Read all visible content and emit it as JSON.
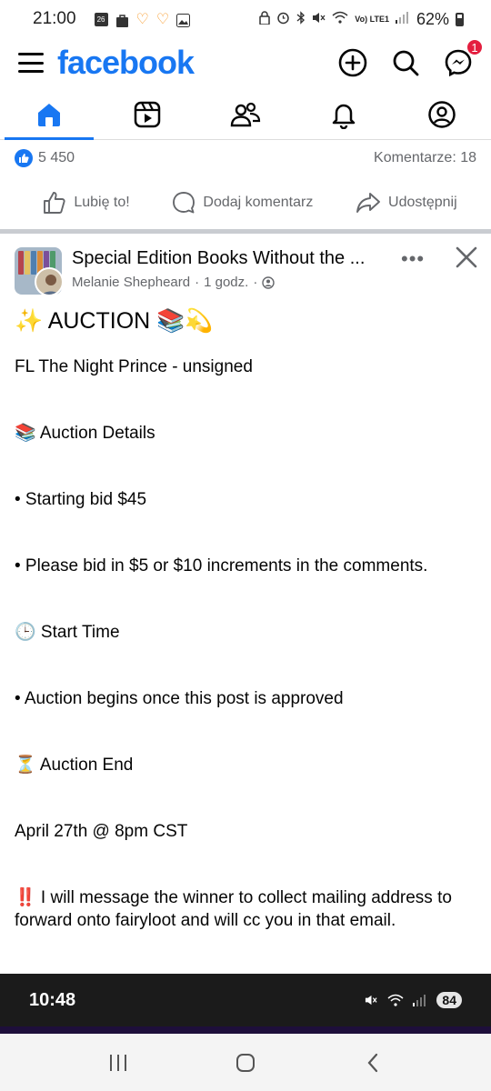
{
  "status_bar": {
    "time": "21:00",
    "calendar_day": "26",
    "network_label": "Vo) LTE1",
    "battery": "62%"
  },
  "header": {
    "logo": "facebook",
    "messenger_badge": "1",
    "brand_color": "#1877f2"
  },
  "tabs": [
    {
      "name": "home",
      "active": true
    },
    {
      "name": "video",
      "active": false
    },
    {
      "name": "friends",
      "active": false
    },
    {
      "name": "notifications",
      "active": false
    },
    {
      "name": "profile",
      "active": false
    }
  ],
  "reactions": {
    "likes": "5 450",
    "comments": "Komentarze: 18"
  },
  "actions": {
    "like": "Lubię to!",
    "comment": "Dodaj komentarz",
    "share": "Udostępnij"
  },
  "post": {
    "group_name": "Special Edition Books Without the ...",
    "author": "Melanie Shepheard",
    "time": "1 godz.",
    "title": "✨ AUCTION 📚💫",
    "lines": [
      "FL The Night Prince - unsigned",
      "📚 Auction Details",
      "• Starting bid $45",
      "• Please bid in $5 or $10 increments in the comments.",
      "🕒 Start Time",
      "• Auction begins once this post is approved",
      "⏳ Auction End",
      "April 27th @ 8pm CST",
      "‼️ I will message the winner to collect mailing address to forward onto fairyloot and will cc you in that email."
    ]
  },
  "overlay": {
    "time": "10:48",
    "battery": "84"
  }
}
